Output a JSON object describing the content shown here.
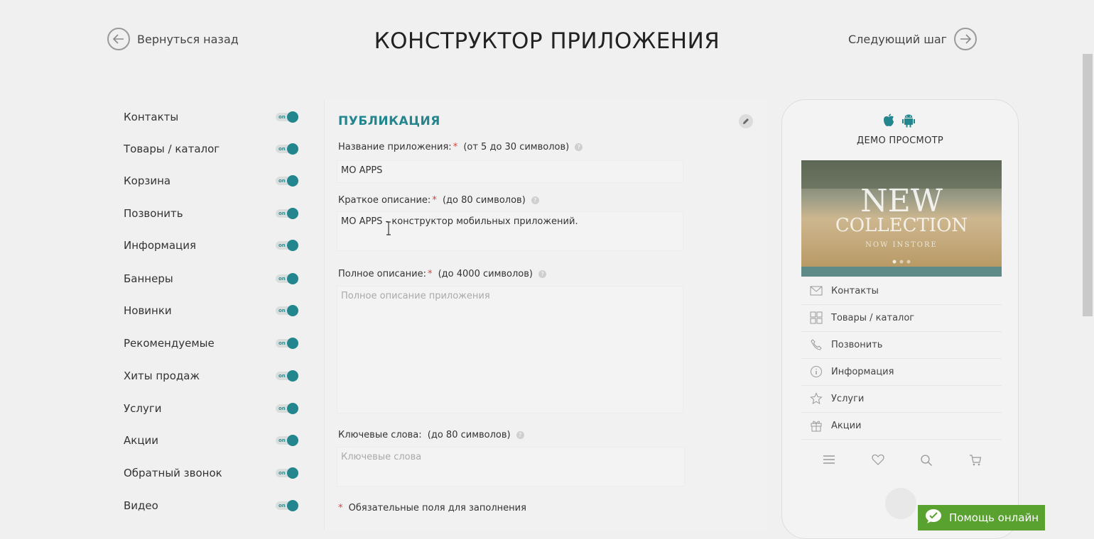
{
  "header": {
    "back_label": "Вернуться назад",
    "title": "КОНСТРУКТОР ПРИЛОЖЕНИЯ",
    "next_label": "Следующий шаг"
  },
  "sidebar": {
    "toggle_text": "on",
    "items": [
      {
        "label": "Контакты",
        "on": true
      },
      {
        "label": "Товары / каталог",
        "on": true
      },
      {
        "label": "Корзина",
        "on": true
      },
      {
        "label": "Позвонить",
        "on": true
      },
      {
        "label": "Информация",
        "on": true
      },
      {
        "label": "Баннеры",
        "on": true
      },
      {
        "label": "Новинки",
        "on": true
      },
      {
        "label": "Рекомендуемые",
        "on": true
      },
      {
        "label": "Хиты продаж",
        "on": true
      },
      {
        "label": "Услуги",
        "on": true
      },
      {
        "label": "Акции",
        "on": true
      },
      {
        "label": "Обратный звонок",
        "on": true
      },
      {
        "label": "Видео",
        "on": true
      }
    ]
  },
  "form": {
    "section_title": "ПУБЛИКАЦИЯ",
    "app_name": {
      "label": "Название приложения:",
      "required": "*",
      "hint": "(от 5 до 30 символов)",
      "value": "MO APPS"
    },
    "short_desc": {
      "label": "Краткое описание:",
      "required": "*",
      "hint": "(до 80 символов)",
      "value": "MO APPS - конструктор мобильных приложений."
    },
    "full_desc": {
      "label": "Полное описание:",
      "required": "*",
      "hint": "(до 4000 символов)",
      "placeholder": "Полное описание приложения"
    },
    "keywords": {
      "label": "Ключевые слова:",
      "hint": "(до 80 символов)",
      "placeholder": "Ключевые слова"
    },
    "required_note_star": "*",
    "required_note": "Обязательные поля для заполнения",
    "help_glyph": "?"
  },
  "preview": {
    "demo_label": "ДЕМО ПРОСМОТР",
    "banner": {
      "line1": "NEW",
      "line2": "COLLECTION",
      "line3": "NOW INSTORE"
    },
    "menu": [
      {
        "label": "Контакты",
        "icon": "mail-icon"
      },
      {
        "label": "Товары / каталог",
        "icon": "grid-icon"
      },
      {
        "label": "Позвонить",
        "icon": "phone-icon"
      },
      {
        "label": "Информация",
        "icon": "info-icon"
      },
      {
        "label": "Услуги",
        "icon": "star-icon"
      },
      {
        "label": "Акции",
        "icon": "gift-icon"
      }
    ]
  },
  "help_chat": {
    "label": "Помощь онлайн"
  },
  "colors": {
    "accent": "#23858d",
    "required": "#e0413a",
    "chat": "#5aa230"
  }
}
